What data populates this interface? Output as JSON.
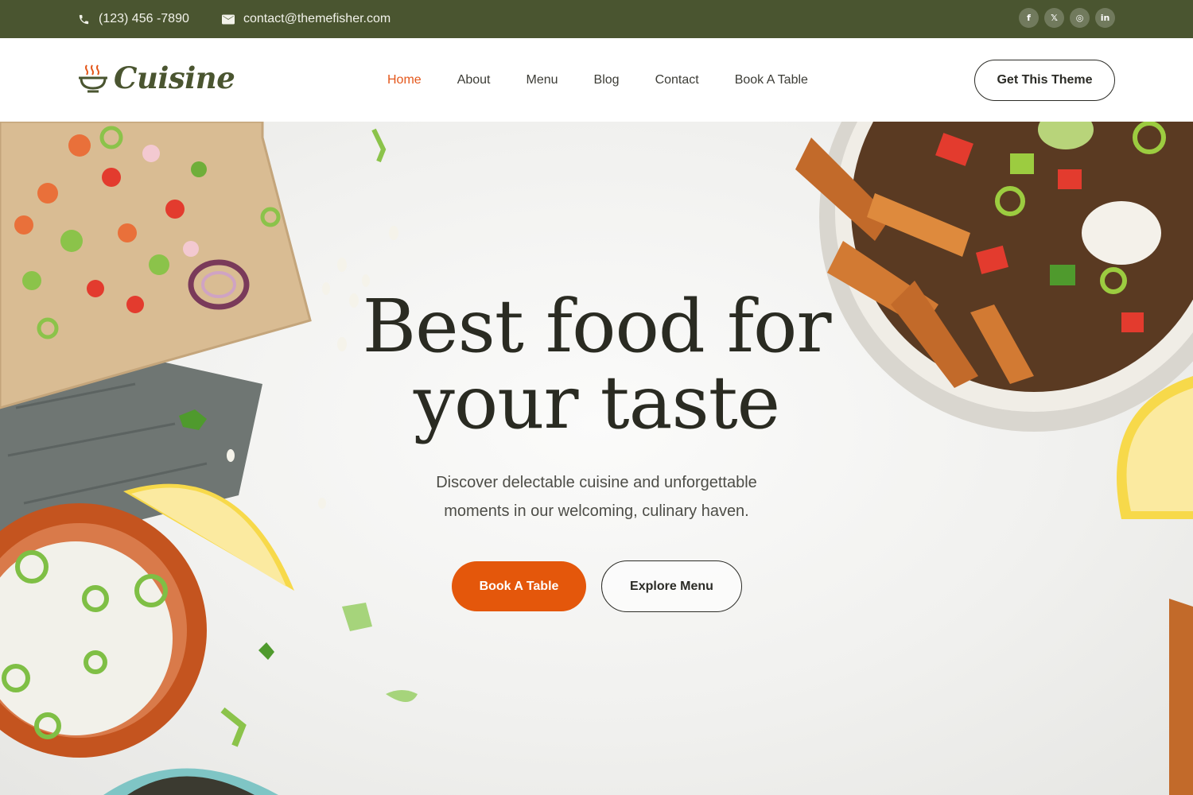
{
  "topbar": {
    "phone": "(123) 456 -7890",
    "email": "contact@themefisher.com",
    "socials": [
      {
        "icon": "facebook-icon",
        "glyph": "f"
      },
      {
        "icon": "x-icon",
        "glyph": "𝕏"
      },
      {
        "icon": "instagram-icon",
        "glyph": "◎"
      },
      {
        "icon": "linkedin-icon",
        "glyph": "in"
      }
    ]
  },
  "header": {
    "logo_text": "Cuisine",
    "nav": [
      {
        "label": "Home",
        "active": true
      },
      {
        "label": "About",
        "active": false
      },
      {
        "label": "Menu",
        "active": false
      },
      {
        "label": "Blog",
        "active": false
      },
      {
        "label": "Contact",
        "active": false
      },
      {
        "label": "Book A Table",
        "active": false
      }
    ],
    "cta_label": "Get This Theme"
  },
  "hero": {
    "title_line1": "Best food for",
    "title_line2": "your taste",
    "subtitle_line1": "Discover delectable cuisine and unforgettable",
    "subtitle_line2": "moments in our welcoming, culinary haven.",
    "primary_button": "Book A Table",
    "secondary_button": "Explore Menu"
  },
  "colors": {
    "topbar_bg": "#4a5530",
    "accent": "#e4571b",
    "brand_green": "#4a5530"
  }
}
